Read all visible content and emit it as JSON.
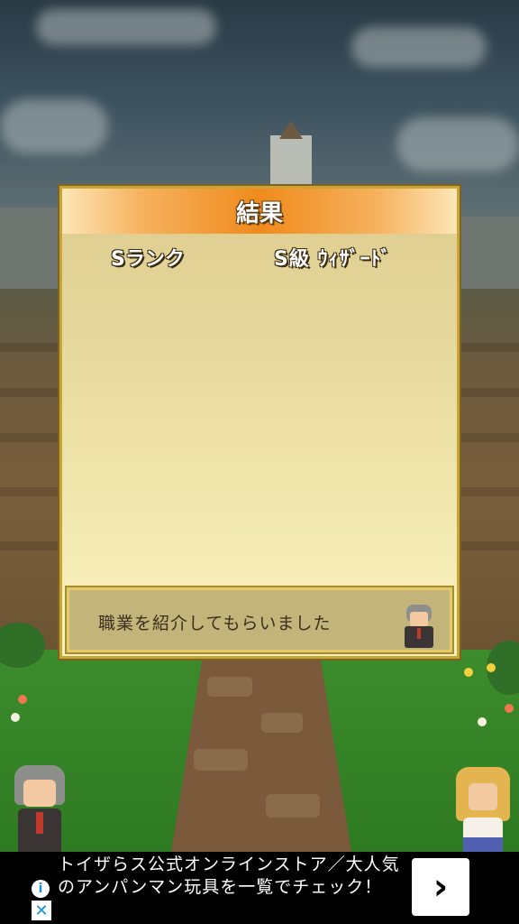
{
  "dialog": {
    "title": "結果",
    "rank": "Sランク",
    "job": "S級 ｳｨｻﾞｰﾄﾞ",
    "message": "職業を紹介してもらいました",
    "portrait_icon": "elder-character-icon"
  },
  "ad": {
    "text": "トイザらス公式オンラインストア／大人気のアンパンマン玩具を一覧でチェック！",
    "arrow_glyph": "›",
    "info_glyph": "i",
    "close_glyph": "✕"
  },
  "colors": {
    "header_orange": "#f08a1c",
    "dialog_border": "#c9a437",
    "ad_background": "#000000"
  }
}
